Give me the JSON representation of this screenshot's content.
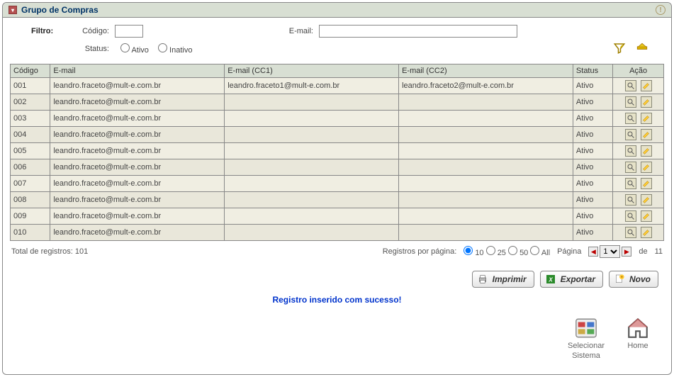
{
  "header": {
    "title": "Grupo de Compras"
  },
  "filter": {
    "label": "Filtro:",
    "codigo_label": "Código:",
    "email_label": "E-mail:",
    "status_label": "Status:",
    "ativo_label": "Ativo",
    "inativo_label": "Inativo"
  },
  "columns": {
    "codigo": "Código",
    "email": "E-mail",
    "cc1": "E-mail (CC1)",
    "cc2": "E-mail (CC2)",
    "status": "Status",
    "acao": "Ação"
  },
  "rows": [
    {
      "codigo": "001",
      "email": "leandro.fraceto@mult-e.com.br",
      "cc1": "leandro.fraceto1@mult-e.com.br",
      "cc2": "leandro.fraceto2@mult-e.com.br",
      "status": "Ativo"
    },
    {
      "codigo": "002",
      "email": "leandro.fraceto@mult-e.com.br",
      "cc1": "",
      "cc2": "",
      "status": "Ativo"
    },
    {
      "codigo": "003",
      "email": "leandro.fraceto@mult-e.com.br",
      "cc1": "",
      "cc2": "",
      "status": "Ativo"
    },
    {
      "codigo": "004",
      "email": "leandro.fraceto@mult-e.com.br",
      "cc1": "",
      "cc2": "",
      "status": "Ativo"
    },
    {
      "codigo": "005",
      "email": "leandro.fraceto@mult-e.com.br",
      "cc1": "",
      "cc2": "",
      "status": "Ativo"
    },
    {
      "codigo": "006",
      "email": "leandro.fraceto@mult-e.com.br",
      "cc1": "",
      "cc2": "",
      "status": "Ativo"
    },
    {
      "codigo": "007",
      "email": "leandro.fraceto@mult-e.com.br",
      "cc1": "",
      "cc2": "",
      "status": "Ativo"
    },
    {
      "codigo": "008",
      "email": "leandro.fraceto@mult-e.com.br",
      "cc1": "",
      "cc2": "",
      "status": "Ativo"
    },
    {
      "codigo": "009",
      "email": "leandro.fraceto@mult-e.com.br",
      "cc1": "",
      "cc2": "",
      "status": "Ativo"
    },
    {
      "codigo": "010",
      "email": "leandro.fraceto@mult-e.com.br",
      "cc1": "",
      "cc2": "",
      "status": "Ativo"
    }
  ],
  "footer": {
    "total_label": "Total de registros: 101",
    "perpage_label": "Registros por página:",
    "opt10": "10",
    "opt25": "25",
    "opt50": "50",
    "optAll": "All",
    "pagina_label": "Página",
    "page_current": "1",
    "de_label": "de",
    "page_total": "11"
  },
  "buttons": {
    "imprimir": "Imprimir",
    "exportar": "Exportar",
    "novo": "Novo"
  },
  "message": "Registro inserido com sucesso!",
  "nav": {
    "selecionar1": "Selecionar",
    "selecionar2": "Sistema",
    "home": "Home"
  }
}
